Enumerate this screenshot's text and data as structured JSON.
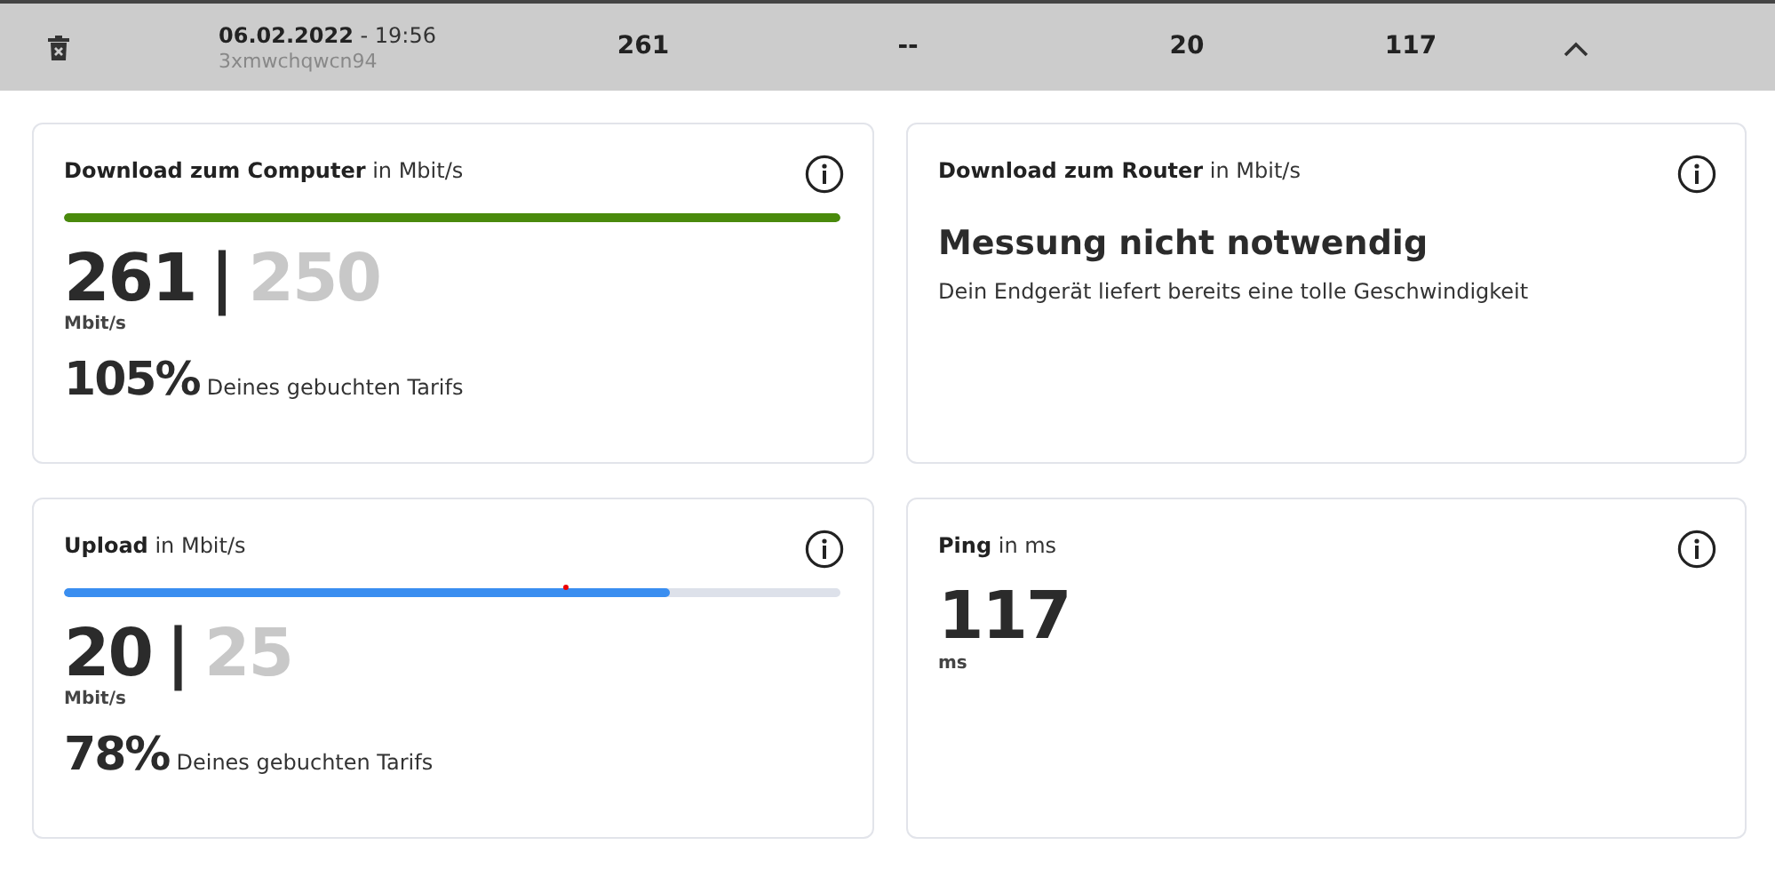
{
  "header_row": {
    "date": "06.02.2022",
    "time": "- 19:56",
    "id": "3xmwchqwcn94",
    "download": "261",
    "router": "--",
    "upload": "20",
    "ping": "117",
    "expanded": true
  },
  "cards": [
    {
      "kind": "meter",
      "title": "**Download zum Computer** in Mbit/s",
      "level": 1,
      "color": "#4a8a0c",
      "value": "261",
      "separator": "|",
      "booked": "250",
      "unit": "Mbit/s",
      "percent": "105%",
      "percent_label": "Deines gebuchten Tarifs"
    },
    {
      "kind": "message",
      "title": "**Download zum Router** in Mbit/s",
      "heading": "Messung nicht notwendig",
      "text": "Dein Endgerät liefert bereits eine tolle Geschwindigkeit"
    },
    {
      "kind": "meter",
      "title": "**Upload** in Mbit/s",
      "level": 0.78,
      "color": "#3a8ef0",
      "value": "20",
      "separator": "|",
      "booked": "25",
      "unit": "Mbit/s",
      "percent": "78%",
      "percent_label": "Deines gebuchten Tarifs"
    },
    {
      "kind": "value",
      "title": "**Ping** in ms",
      "value": "117",
      "unit": "ms"
    }
  ]
}
